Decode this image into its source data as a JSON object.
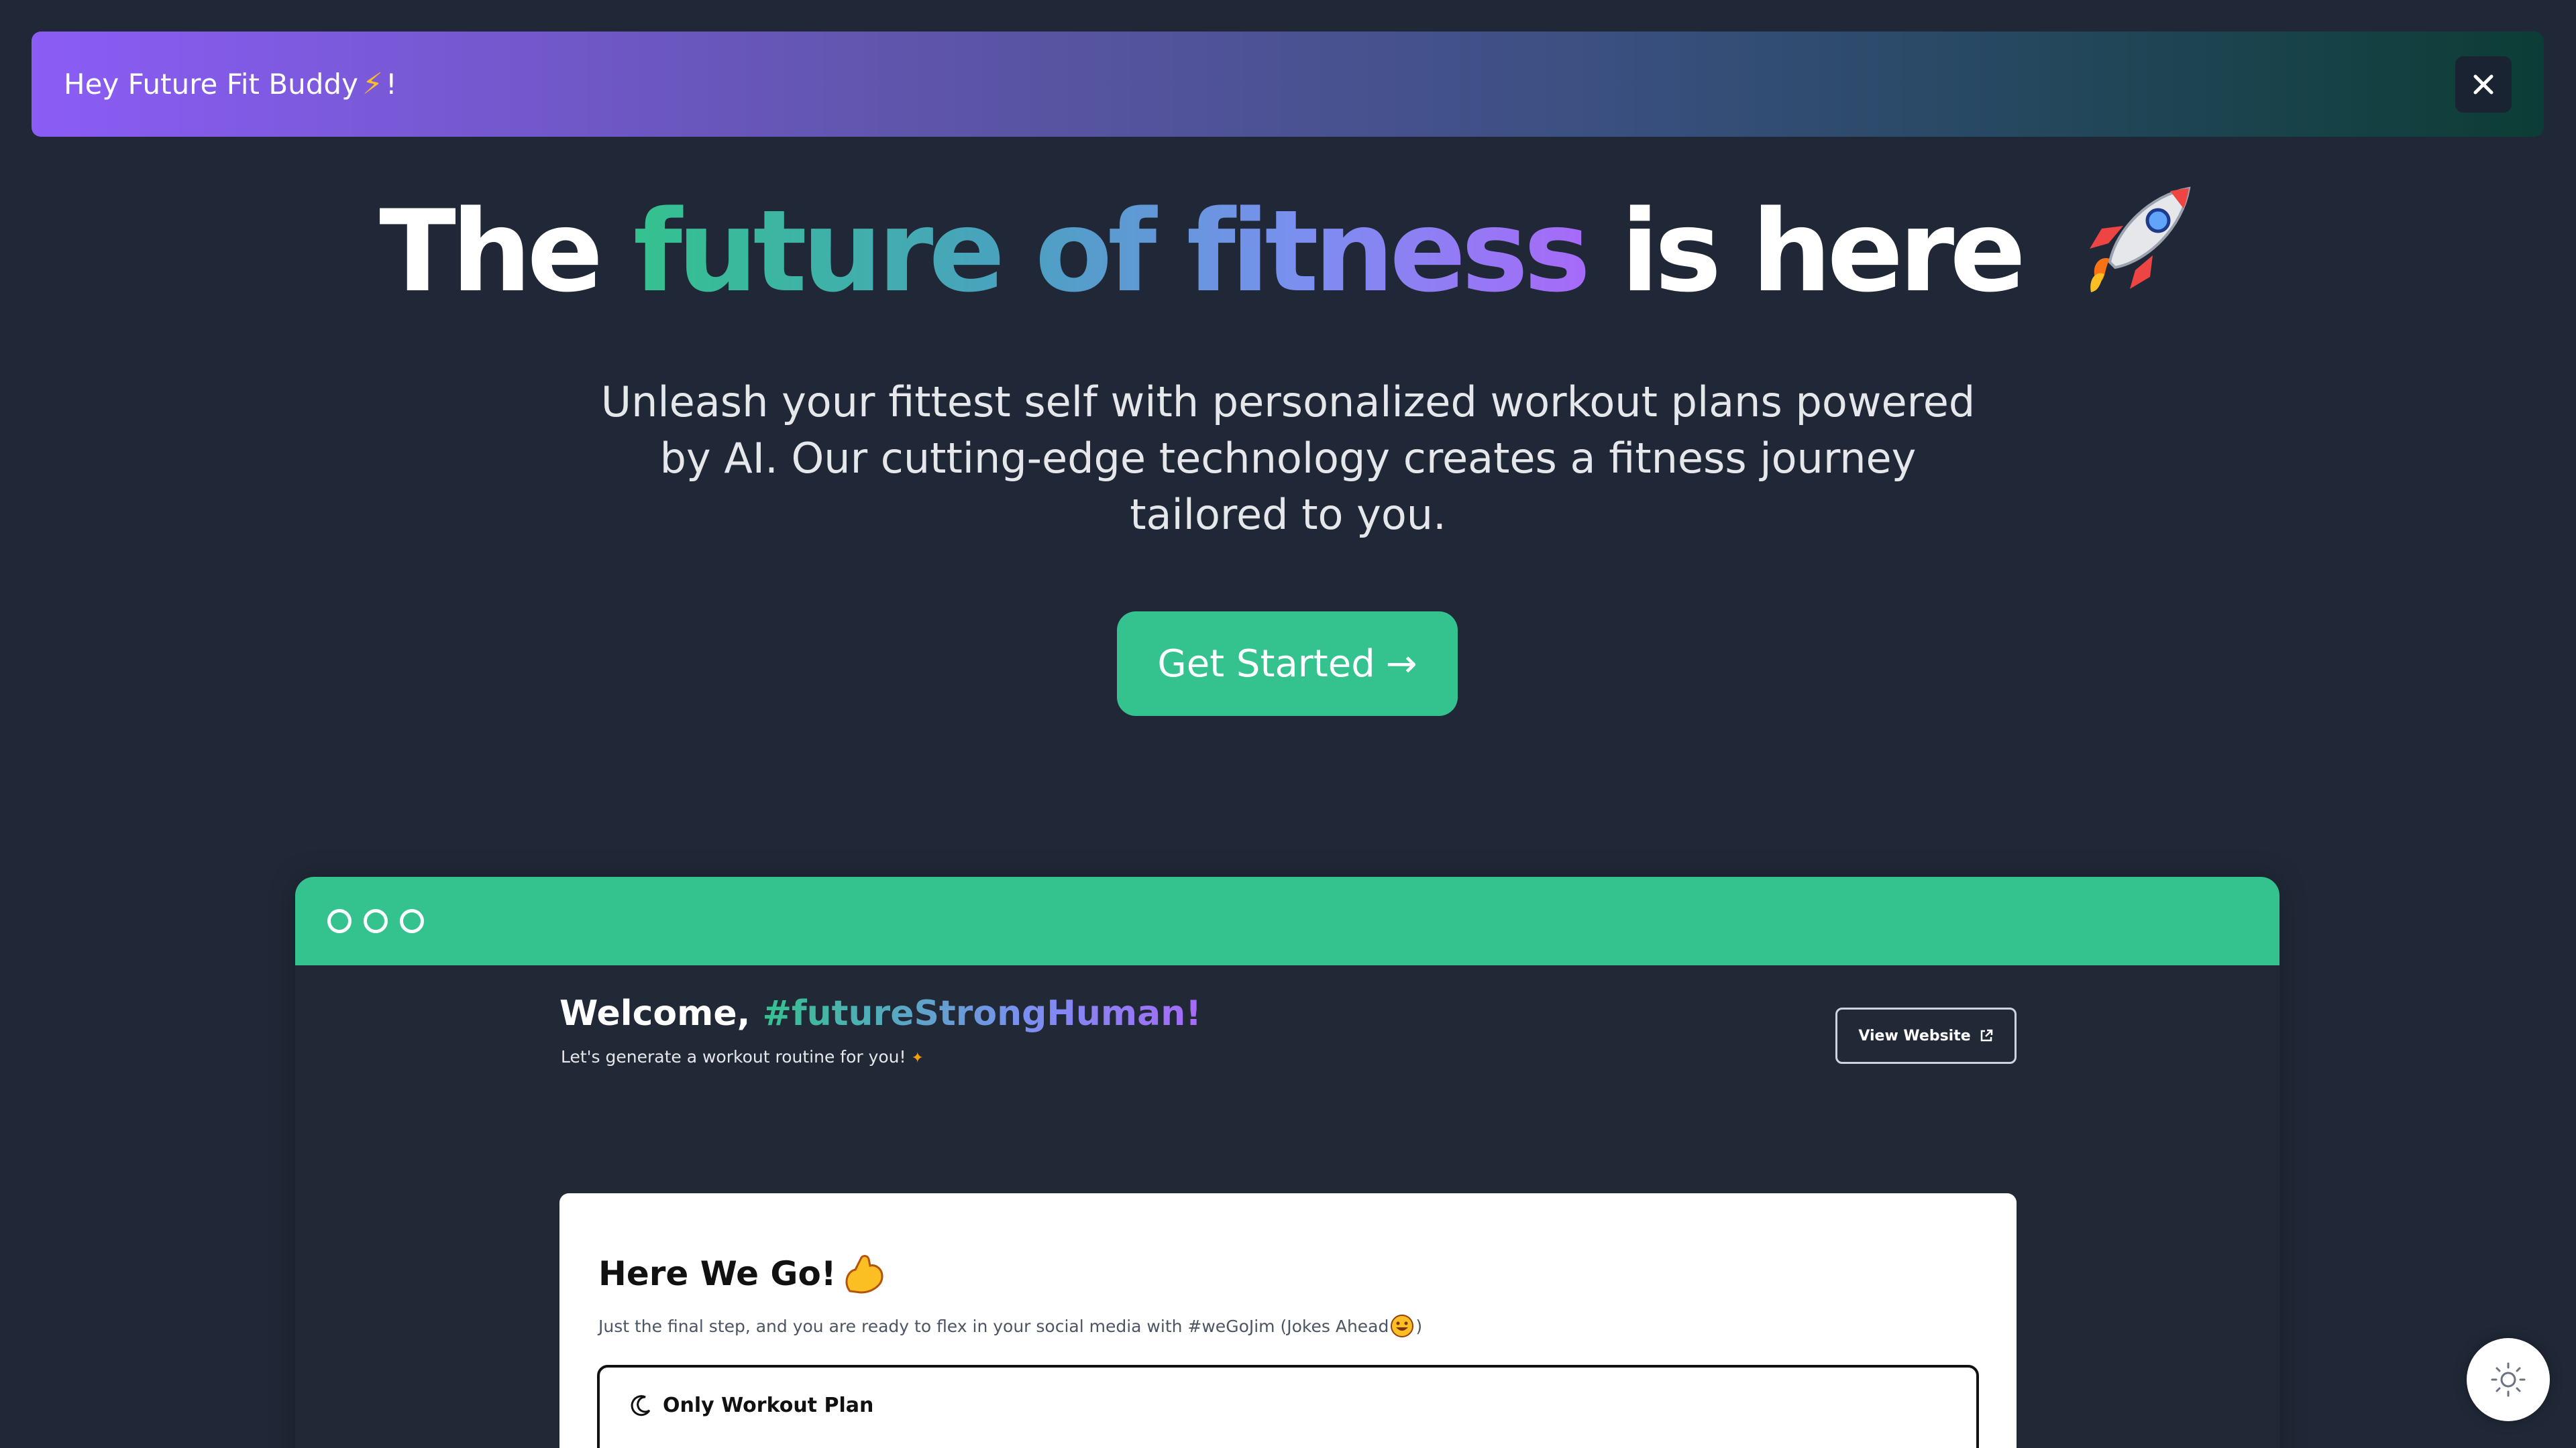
{
  "banner": {
    "greeting": "Hey Future Fit Buddy",
    "suffix": "!",
    "icon": "bolt-icon",
    "close_icon": "close-icon"
  },
  "hero": {
    "title_start": "The",
    "title_highlight": "future of fitness",
    "title_end": "is here",
    "title_icon": "rocket-icon",
    "subtitle": "Unleash your fittest self with personalized workout plans powered by AI. Our cutting-edge technology creates a fitness journey tailored to you.",
    "cta_label": "Get Started",
    "cta_arrow": "→"
  },
  "preview": {
    "welcome_prefix": "Welcome,",
    "welcome_tag": "#futureStrongHuman!",
    "welcome_sub": "Let's generate a workout routine for you!",
    "view_website_label": "View Website",
    "card": {
      "title": "Here We Go!",
      "subtitle_start": "Just the final step, and you are ready to flex in your social media with #weGoJim (Jokes Ahead",
      "subtitle_end": ")",
      "option_label": "Only Workout Plan"
    }
  },
  "colors": {
    "background": "#202837",
    "accent": "#34c38f",
    "banner_start": "#8b5cf6",
    "banner_end": "#0c3d35"
  }
}
